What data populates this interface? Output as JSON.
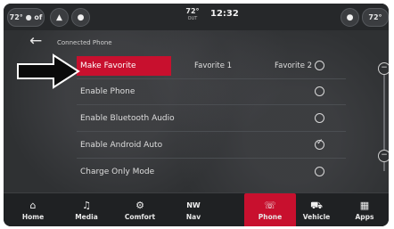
{
  "status_bar": {
    "left_temp": "72°",
    "left_fan_mode": "● of",
    "center_temp": "72°",
    "center_temp_sub": "OUT",
    "time": "12:32",
    "right_temp": "72°"
  },
  "header": {
    "title": "Connected Phone"
  },
  "settings": {
    "rows": [
      {
        "label": "Make Favorite",
        "checked": false
      },
      {
        "label": "Enable Phone",
        "checked": false
      },
      {
        "label": "Enable Bluetooth Audio",
        "checked": false
      },
      {
        "label": "Enable Android Auto",
        "checked": true
      },
      {
        "label": "Charge Only Mode",
        "checked": false
      }
    ],
    "favorite_1": "Favorite 1",
    "favorite_2": "Favorite 2"
  },
  "nav": {
    "items": [
      {
        "label": "Home",
        "icon": "home-icon"
      },
      {
        "label": "Media",
        "icon": "music-note-icon"
      },
      {
        "label": "Comfort",
        "icon": "seat-heat-icon"
      },
      {
        "label": "Nav",
        "icon": "compass-icon",
        "icon_text": "NW"
      },
      {
        "label": "Phone",
        "icon": "phone-icon"
      },
      {
        "label": "Vehicle",
        "icon": "car-icon"
      },
      {
        "label": "Apps",
        "icon": "grid-icon"
      }
    ],
    "active": "Phone"
  },
  "colors": {
    "accent": "#c8102e",
    "background": "#2f3133"
  }
}
